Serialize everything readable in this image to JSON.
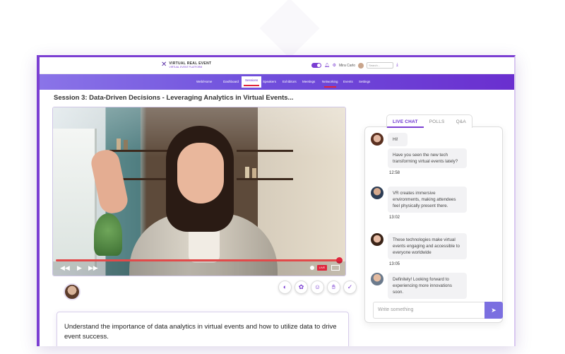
{
  "header": {
    "logo_text": "VIRTUAL REAL EVENT",
    "logo_subtext": "VIRTUAL EVENT PLATFORM",
    "user_name": "Mira Carlo",
    "search_placeholder": "Search..."
  },
  "nav": {
    "items": [
      {
        "label": "Web/Home"
      },
      {
        "label": "Dashboard"
      },
      {
        "label": "Sessions"
      },
      {
        "label": "Speakers"
      },
      {
        "label": "Exhibitors"
      },
      {
        "label": "Meetings"
      },
      {
        "label": "Networking"
      },
      {
        "label": "Events"
      },
      {
        "label": "Settings"
      }
    ]
  },
  "session": {
    "title": "Session 3: Data-Driven Decisions - Leveraging Analytics in Virtual Events...",
    "description": "Understand the importance of data analytics in virtual events and how to utilize data to drive event success.",
    "live_badge": "LIVE",
    "progress": 0.99
  },
  "chat": {
    "tabs": [
      {
        "label": "LIVE CHAT"
      },
      {
        "label": "POLLS"
      },
      {
        "label": "Q&A"
      }
    ],
    "messages": [
      {
        "bubbles": [
          "Hi!",
          "Have you seen the new tech transforming virtual events lately?"
        ],
        "time": "12:58"
      },
      {
        "bubbles": [
          "VR creates immersive environments, making attendees feel physically present there."
        ],
        "time": "13:02"
      },
      {
        "bubbles": [
          "These technologies make virtual events engaging and accessible to everyone worldwide"
        ],
        "time": "13:05"
      },
      {
        "bubbles": [
          "Definitely! Looking forward to experiencing more innovations soon."
        ],
        "time": ""
      }
    ],
    "composer_placeholder": "Write something",
    "send_icon": "send-icon"
  },
  "colors": {
    "accent": "#7b3fd2",
    "nav_gradient_start": "#8a74e8",
    "nav_gradient_end": "#6a2fcf",
    "live_red": "#e0243c"
  }
}
